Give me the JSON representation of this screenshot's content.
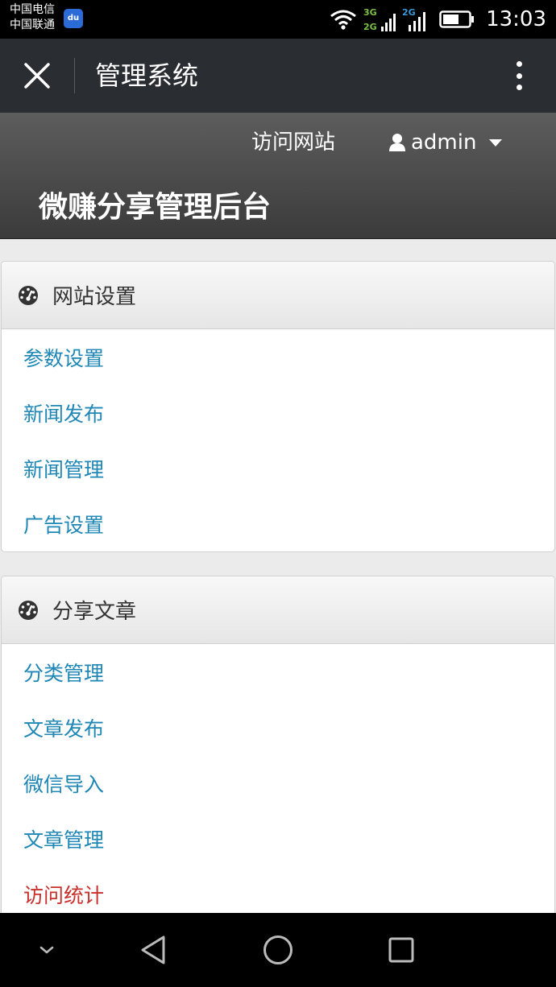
{
  "status": {
    "carrier_1": "中国电信",
    "carrier_2": "中国联通",
    "baidu_icon_text": "du",
    "net_1a": "3G",
    "net_1b": "2G",
    "net_2": "2G",
    "time": "13:03"
  },
  "appbar": {
    "title": "管理系统"
  },
  "header": {
    "visit_site": "访问网站",
    "user": "admin",
    "site_title": "微赚分享管理后台"
  },
  "panels": [
    {
      "title": "网站设置",
      "icon": "dashboard-icon",
      "items": [
        "参数设置",
        "新闻发布",
        "新闻管理",
        "广告设置"
      ]
    },
    {
      "title": "分享文章",
      "icon": "dashboard-icon",
      "items": [
        "分类管理",
        "文章发布",
        "微信导入",
        "文章管理",
        "访问统计"
      ]
    }
  ],
  "colors": {
    "link": "#1f87b5",
    "active_link": "#c9302c",
    "appbar": "#2a2e33"
  }
}
